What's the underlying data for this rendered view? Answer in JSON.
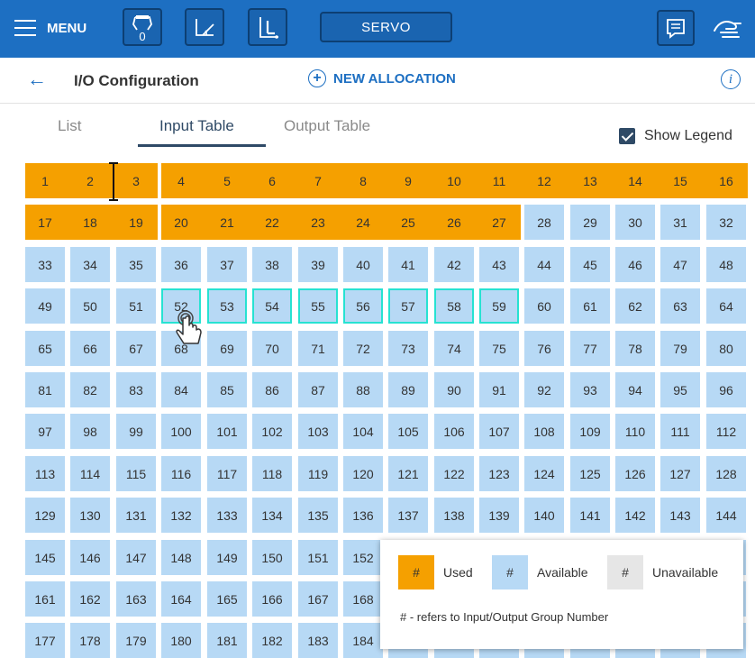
{
  "topbar": {
    "menu_label": "MENU",
    "counter_badge": "0",
    "servo_label": "SERVO",
    "icons": [
      "robot-counter-icon",
      "frame-angle-icon",
      "coordinate-icon",
      "message-icon",
      "hand-icon"
    ]
  },
  "header": {
    "title": "I/O Configuration",
    "new_allocation_label": "NEW ALLOCATION",
    "info_label": "i"
  },
  "tabs": [
    {
      "label": "List",
      "active": false
    },
    {
      "label": "Input Table",
      "active": true
    },
    {
      "label": "Output Table",
      "active": false
    }
  ],
  "show_legend": {
    "label": "Show Legend",
    "checked": true
  },
  "grid": {
    "columns": 16,
    "total": 192,
    "used": [
      1,
      2,
      3,
      4,
      5,
      6,
      7,
      8,
      9,
      10,
      11,
      12,
      13,
      14,
      15,
      16,
      17,
      18,
      19,
      20,
      21,
      22,
      23,
      24,
      25,
      26,
      27
    ],
    "selected": [
      52,
      53,
      54,
      55,
      56,
      57,
      58,
      59
    ]
  },
  "legend": {
    "used_symbol": "#",
    "used_label": "Used",
    "available_symbol": "#",
    "available_label": "Available",
    "unavailable_symbol": "#",
    "unavailable_label": "Unavailable",
    "note": "# - refers to Input/Output Group Number"
  },
  "colors": {
    "topbar": "#1d6fc2",
    "used": "#f5a000",
    "available": "#b7d9f5",
    "unavailable": "#e6e6e6",
    "selected_border": "#27e2d2",
    "tab_active": "#2f4a66"
  }
}
